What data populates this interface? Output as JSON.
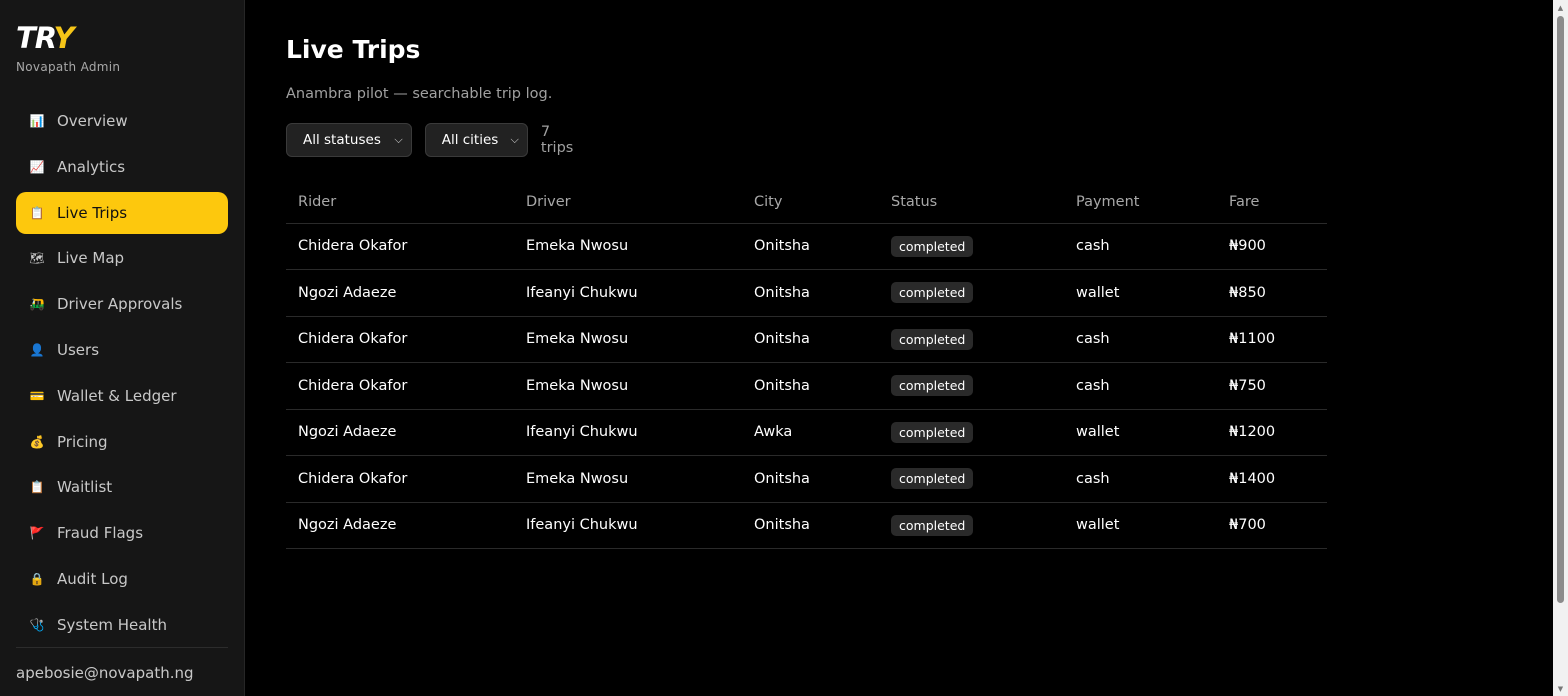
{
  "brand": {
    "logo_main": "TRY",
    "logo_accent": "",
    "subtitle": "Novapath Admin"
  },
  "nav": [
    {
      "label": "Overview",
      "icon": "📊",
      "active": false
    },
    {
      "label": "Analytics",
      "icon": "📈",
      "active": false
    },
    {
      "label": "Live Trips",
      "icon": "📋",
      "active": true
    },
    {
      "label": "Live Map",
      "icon": "🗺",
      "active": false
    },
    {
      "label": "Driver Approvals",
      "icon": "🛺",
      "active": false
    },
    {
      "label": "Users",
      "icon": "👤",
      "active": false
    },
    {
      "label": "Wallet & Ledger",
      "icon": "💳",
      "active": false
    },
    {
      "label": "Pricing",
      "icon": "💰",
      "active": false
    },
    {
      "label": "Waitlist",
      "icon": "📋",
      "active": false
    },
    {
      "label": "Fraud Flags",
      "icon": "🚩",
      "active": false
    },
    {
      "label": "Audit Log",
      "icon": "🔒",
      "active": false
    },
    {
      "label": "System Health",
      "icon": "🩺",
      "active": false
    }
  ],
  "user": {
    "email": "apebosie@novapath.ng"
  },
  "page": {
    "title": "Live Trips",
    "subtitle": "Anambra pilot — searchable trip log."
  },
  "filters": {
    "status": "All statuses",
    "city": "All cities",
    "count": "7 trips"
  },
  "table": {
    "columns": [
      "Rider",
      "Driver",
      "City",
      "Status",
      "Payment",
      "Fare"
    ],
    "rows": [
      [
        "Chidera Okafor",
        "Emeka Nwosu",
        "Onitsha",
        "completed",
        "cash",
        "₦900"
      ],
      [
        "Ngozi Adaeze",
        "Ifeanyi Chukwu",
        "Onitsha",
        "completed",
        "wallet",
        "₦850"
      ],
      [
        "Chidera Okafor",
        "Emeka Nwosu",
        "Onitsha",
        "completed",
        "cash",
        "₦1100"
      ],
      [
        "Chidera Okafor",
        "Emeka Nwosu",
        "Onitsha",
        "completed",
        "cash",
        "₦750"
      ],
      [
        "Ngozi Adaeze",
        "Ifeanyi Chukwu",
        "Awka",
        "completed",
        "wallet",
        "₦1200"
      ],
      [
        "Chidera Okafor",
        "Emeka Nwosu",
        "Onitsha",
        "completed",
        "cash",
        "₦1400"
      ],
      [
        "Ngozi Adaeze",
        "Ifeanyi Chukwu",
        "Onitsha",
        "completed",
        "wallet",
        "₦700"
      ]
    ]
  },
  "colors": {
    "accent": "#fdc80d",
    "background": "#000000",
    "sidebar": "#161616"
  }
}
